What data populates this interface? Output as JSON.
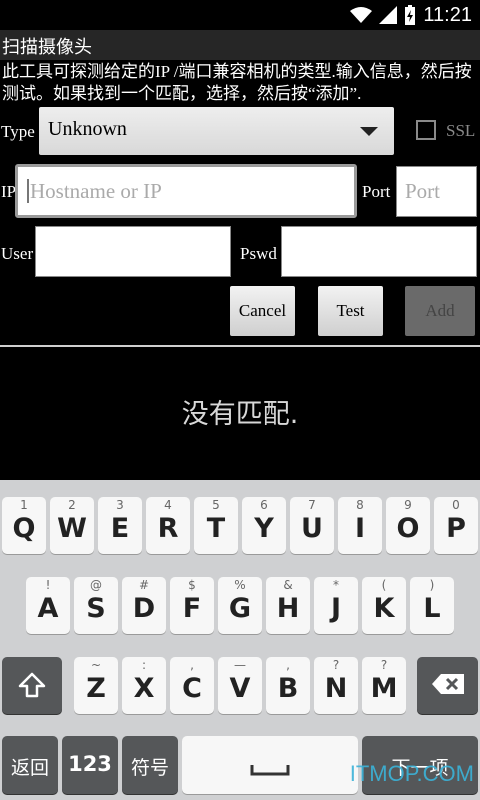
{
  "status_bar": {
    "time": "11:21"
  },
  "title_bar": {
    "title": "扫描摄像头"
  },
  "description": "此工具可探测给定的IP /端口兼容相机的类型.输入信息，然后按测试。如果找到一个匹配，选择，然后按“添加”.",
  "form": {
    "type_label": "Type",
    "type_value": "Unknown",
    "ssl_label": "SSL",
    "ssl_checked": false,
    "ip_label": "IP",
    "ip_placeholder": "Hostname or IP",
    "ip_value": "",
    "port_label": "Port",
    "port_placeholder": "Port",
    "user_label": "User",
    "user_value": "",
    "pswd_label": "Pswd",
    "pswd_value": ""
  },
  "buttons": {
    "cancel": "Cancel",
    "test": "Test",
    "add": "Add"
  },
  "result_text": "没有匹配.",
  "keyboard": {
    "row1": [
      {
        "hint": "1",
        "key": "Q"
      },
      {
        "hint": "2",
        "key": "W"
      },
      {
        "hint": "3",
        "key": "E"
      },
      {
        "hint": "4",
        "key": "R"
      },
      {
        "hint": "5",
        "key": "T"
      },
      {
        "hint": "6",
        "key": "Y"
      },
      {
        "hint": "7",
        "key": "U"
      },
      {
        "hint": "8",
        "key": "I"
      },
      {
        "hint": "9",
        "key": "O"
      },
      {
        "hint": "0",
        "key": "P"
      }
    ],
    "row2": [
      {
        "hint": "!",
        "key": "A"
      },
      {
        "hint": "@",
        "key": "S"
      },
      {
        "hint": "#",
        "key": "D"
      },
      {
        "hint": "$",
        "key": "F"
      },
      {
        "hint": "%",
        "key": "G"
      },
      {
        "hint": "&",
        "key": "H"
      },
      {
        "hint": "*",
        "key": "J"
      },
      {
        "hint": "(",
        "key": "K"
      },
      {
        "hint": ")",
        "key": "L"
      }
    ],
    "row3": [
      {
        "hint": "~",
        "key": "Z"
      },
      {
        "hint": ":",
        "key": "X"
      },
      {
        "hint": ",",
        "key": "C"
      },
      {
        "hint": "—",
        "key": "V"
      },
      {
        "hint": ",",
        "key": "B"
      },
      {
        "hint": "?",
        "key": "N"
      },
      {
        "hint": "?",
        "key": "M"
      }
    ],
    "back_label": "返回",
    "num_label": "123",
    "symbol_label": "符号",
    "next_label": "下一项"
  },
  "watermark": "ITMOP.COM",
  "colors": {
    "watermark": "#3bb3d9",
    "keyboard_bg": "#cfd0d2",
    "title_bar_bg": "#262626"
  }
}
